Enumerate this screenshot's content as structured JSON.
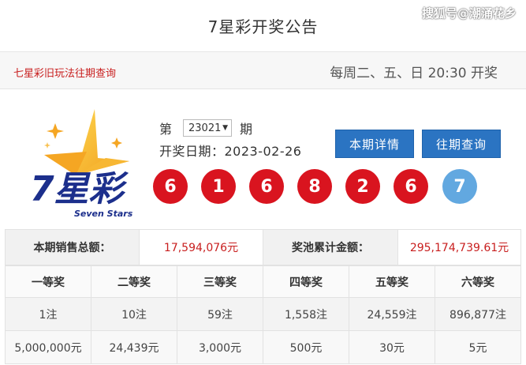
{
  "header": {
    "title": "7星彩开奖公告",
    "watermark": "搜狐号@潮涌花乡"
  },
  "subbar": {
    "link_label": "七星彩旧玩法往期查询",
    "schedule": "每周二、五、日 20:30 开奖"
  },
  "logo": {
    "main_text": "7星彩",
    "sub_text": "Seven Stars"
  },
  "issue": {
    "prefix": "第",
    "number": "23021",
    "suffix": "期"
  },
  "draw_date": "开奖日期：2023-02-26",
  "buttons": {
    "current": "本期详情",
    "history": "往期查询"
  },
  "balls": {
    "main": [
      "6",
      "1",
      "6",
      "8",
      "2",
      "6"
    ],
    "special": "7"
  },
  "sales": {
    "total_label": "本期销售总额：",
    "total_value": "17,594,076元",
    "pool_label": "奖池累计金额：",
    "pool_value": "295,174,739.61元"
  },
  "prizes": {
    "headers": [
      "一等奖",
      "二等奖",
      "三等奖",
      "四等奖",
      "五等奖",
      "六等奖"
    ],
    "counts": [
      "1注",
      "10注",
      "59注",
      "1,558注",
      "24,559注",
      "896,877注"
    ],
    "amounts": [
      "5,000,000元",
      "24,439元",
      "3,000元",
      "500元",
      "30元",
      "5元"
    ]
  },
  "colors": {
    "accent_red": "#d9141f",
    "special_blue": "#62a8e0",
    "button_blue": "#2b74c2"
  }
}
